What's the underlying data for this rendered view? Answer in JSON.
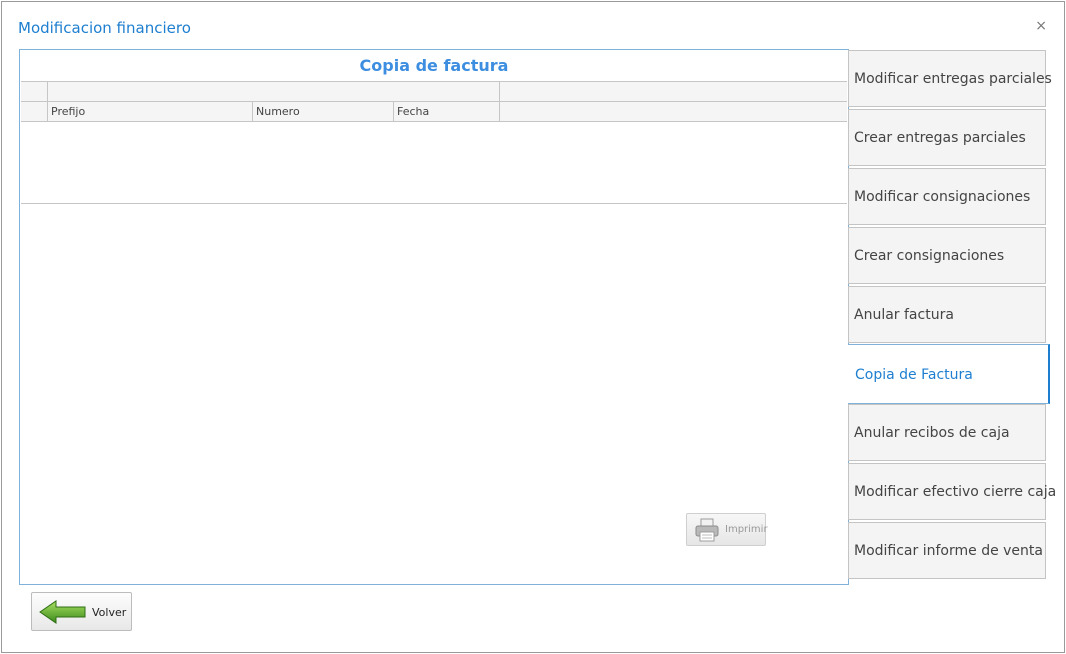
{
  "window": {
    "title": "Modificacion financiero",
    "close_label": "×"
  },
  "panel": {
    "title": "Copia de factura"
  },
  "grid": {
    "columns": [
      "Prefijo",
      "Numero",
      "Fecha"
    ]
  },
  "print_button": {
    "label": "Imprimir",
    "icon": "printer-icon"
  },
  "menu": {
    "items": [
      {
        "label": "Modificar entregas parciales"
      },
      {
        "label": "Crear entregas parciales"
      },
      {
        "label": "Modificar consignaciones"
      },
      {
        "label": "Crear consignaciones"
      },
      {
        "label": "Anular factura"
      },
      {
        "label": "Copia de Factura",
        "active": true
      },
      {
        "label": "Anular recibos de caja"
      },
      {
        "label": "Modificar efectivo cierre caja"
      },
      {
        "label": "Modificar informe de venta"
      }
    ]
  },
  "back_button": {
    "label": "Volver",
    "icon": "back-arrow-icon"
  },
  "colors": {
    "accent": "#1e7fd0",
    "panel_border": "#7fb2db"
  }
}
